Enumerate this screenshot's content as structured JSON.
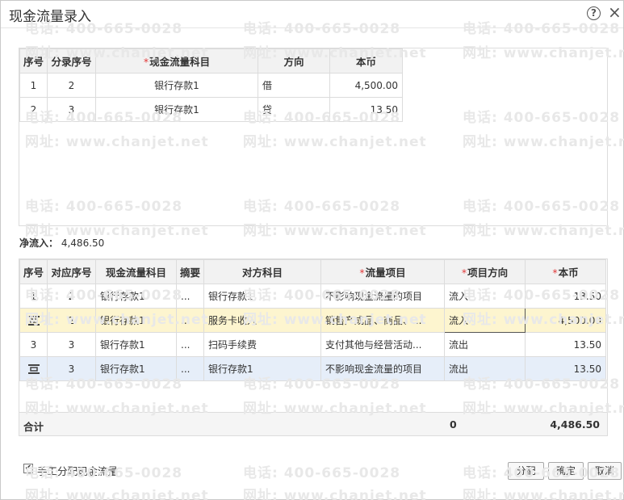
{
  "window": {
    "title": "现金流量录入",
    "help_icon": "question-circle-icon",
    "close_icon": "close-icon"
  },
  "watermark": {
    "phone": "电话: 400-665-0028",
    "site": "网址: www.chanjet.net"
  },
  "top_table": {
    "headers": [
      "序号",
      "分录序号",
      "现金流量科目",
      "方向",
      "本币"
    ],
    "required_mark": "*",
    "rows": [
      {
        "seq": "1",
        "entry_seq": "2",
        "subject": "银行存款1",
        "direction": "借",
        "amount": "4,500.00"
      },
      {
        "seq": "2",
        "entry_seq": "3",
        "subject": "银行存款1",
        "direction": "贷",
        "amount": "13.50"
      }
    ]
  },
  "net_inflow": {
    "label": "净流入：",
    "value": "4,486.50"
  },
  "bottom_table": {
    "headers": [
      "序号",
      "对应序号",
      "现金流量科目",
      "摘要",
      "对方科目",
      "流量项目",
      "项目方向",
      "本币"
    ],
    "required_mark": "*",
    "rows": [
      {
        "seq": "1",
        "corr_seq": "2",
        "subject": "银行存款1",
        "summary": "...",
        "counter_subject": "银行存款1",
        "flow_item": "不影响现金流量的项目",
        "item_direction": "流入",
        "amount": "13.50"
      },
      {
        "seq": "",
        "corr_seq": "2",
        "subject": "银行存款1",
        "summary": "...",
        "counter_subject": "服务卡收入",
        "flow_item": "销售产成品、商品、...",
        "item_direction": "流入",
        "amount": "4,500.00"
      },
      {
        "seq": "3",
        "corr_seq": "3",
        "subject": "银行存款1",
        "summary": "...",
        "counter_subject": "扫码手续费",
        "flow_item": "支付其他与经营活动...",
        "item_direction": "流出",
        "amount": "13.50"
      },
      {
        "seq": "",
        "corr_seq": "3",
        "subject": "银行存款1",
        "summary": "...",
        "counter_subject": "银行存款1",
        "flow_item": "不影响现金流量的项目",
        "item_direction": "流出",
        "amount": "13.50"
      }
    ],
    "total": {
      "label": "合计",
      "item_direction_total": "0",
      "amount": "4,486.50"
    }
  },
  "footer": {
    "checkbox_label": "手工分配现金流量",
    "checkbox_checked": true,
    "checkbox_mark": "✔",
    "buttons": {
      "allocate": "分配",
      "ok": "确定",
      "cancel": "取消"
    }
  }
}
